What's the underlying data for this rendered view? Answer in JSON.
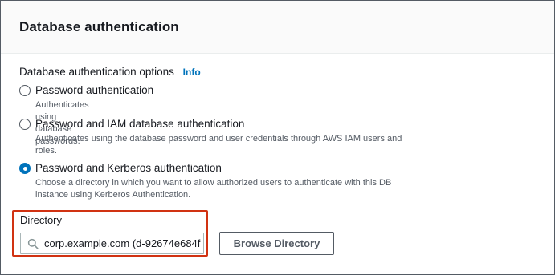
{
  "panel": {
    "title": "Database authentication",
    "options_label": "Database authentication options",
    "info_link": "Info"
  },
  "options": [
    {
      "title": "Password authentication",
      "description": "Authenticates using database passwords.",
      "selected": false
    },
    {
      "title": "Password and IAM database authentication",
      "description": "Authenticates using the database password and user credentials through AWS IAM users and roles.",
      "selected": false
    },
    {
      "title": "Password and Kerberos authentication",
      "description": "Choose a directory in which you want to allow authorized users to authenticate with this DB instance using Kerberos Authentication.",
      "selected": true
    }
  ],
  "directory": {
    "label": "Directory",
    "value": "corp.example.com (d-92674e684f",
    "icon": "search-icon",
    "browse_label": "Browse Directory"
  },
  "colors": {
    "accent": "#0073bb",
    "highlight_border": "#d13212",
    "header_bg": "#fafafa"
  }
}
